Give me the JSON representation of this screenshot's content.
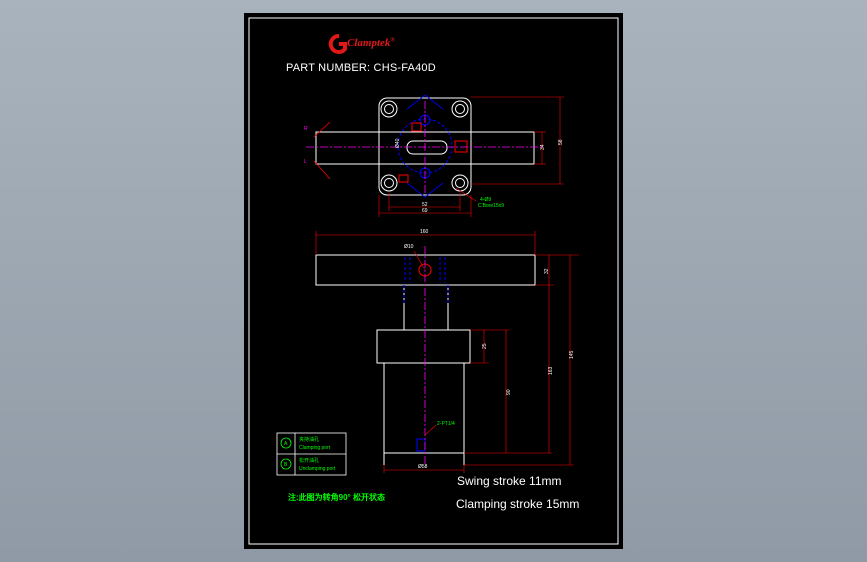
{
  "brand": {
    "name": "Clamptek",
    "mark": "G",
    "registered": "®"
  },
  "part_number": "PART NUMBER:  CHS-FA40D",
  "swing_stroke": "Swing stroke 11mm",
  "clamping_stroke": "Clamping stroke 15mm",
  "note_cn": "注:此图为转角90° 松开状态",
  "legend": [
    {
      "symbol": "A",
      "label_cn": "夹持油孔",
      "label_en": "Clamping port"
    },
    {
      "symbol": "B",
      "label_cn": "松开油孔",
      "label_en": "Unclamping port"
    }
  ],
  "top_view": {
    "direction_r": "R",
    "direction_l": "L",
    "dims": {
      "width_52": "52",
      "width_69": "69",
      "height_34": "34",
      "height_58": "58",
      "dia_40": "Ø40",
      "hole_callout_1": "4-Ø9",
      "hole_callout_2": "C'Bore15x9"
    }
  },
  "front_view": {
    "dims": {
      "arm_length": "160",
      "arm_height": "32",
      "pin_dia": "Ø10",
      "flange_height": "25",
      "body_height": "90",
      "total_163": "163",
      "total_145": "145",
      "port": "2-PT1/4",
      "base_dia": "Ø58"
    }
  },
  "colors": {
    "background": "#000000",
    "outline": "#ffffff",
    "dimension": "#ff0000",
    "centerline": "#ff00ff",
    "blue": "#0000ff",
    "green_text": "#00ff00",
    "brand": "#e01818"
  }
}
